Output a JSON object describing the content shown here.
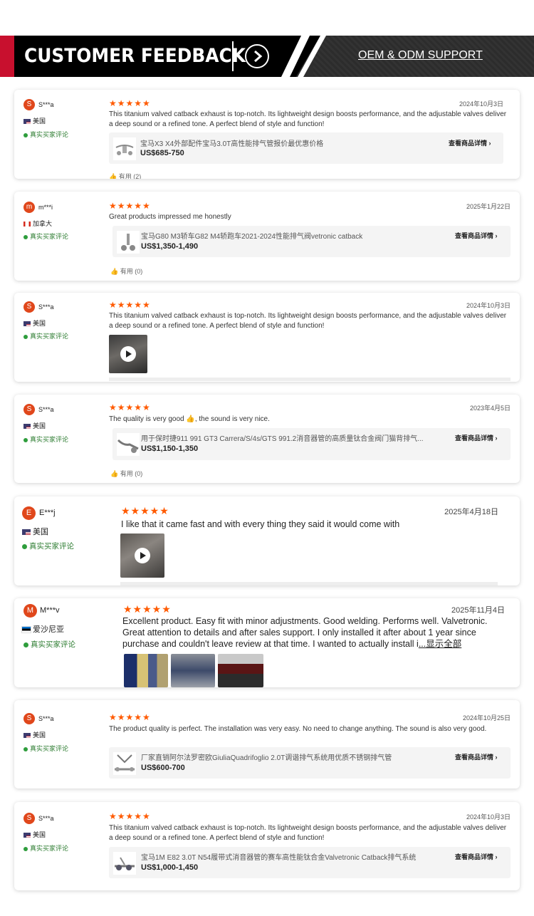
{
  "banner": {
    "title": "CUSTOMER FEEDBACK",
    "support": "OEM & ODM SUPPORT",
    "accent_red": "#c8102e"
  },
  "icons": {
    "arrow": "chevron-right-icon",
    "thumb": "thumbs-up-icon",
    "play": "play-icon",
    "verified": "check-dot-icon"
  },
  "reviews": [
    {
      "initial": "S",
      "user": "S***a",
      "country": "美国",
      "verified": "真实买家评论",
      "stars": "★★★★★",
      "date": "2024年10月3日",
      "text": "This titanium valved catback exhaust is top-notch. Its lightweight design boosts performance, and the adjustable valves deliver a deep sound or a refined tone. A perfect blend of style and function!",
      "product": "宝马X3 X4外部配件宝马3.0T高性能排气管报价最优惠价格",
      "price": "US$685-750",
      "link": "查看商品详情 ›",
      "helpful": "有用 (2)"
    },
    {
      "initial": "m",
      "user": "m***i",
      "country": "加拿大",
      "verified": "真实买家评论",
      "stars": "★★★★★",
      "date": "2025年1月22日",
      "text": "Great products impressed me honestly",
      "product": "宝马G80 M3轿车G82 M4轿跑车2021-2024性能排气阀vetronic catback",
      "price": "US$1,350-1,490",
      "link": "查看商品详情 ›",
      "helpful": "有用 (0)"
    },
    {
      "initial": "S",
      "user": "S***a",
      "country": "美国",
      "verified": "真实买家评论",
      "stars": "★★★★★",
      "date": "2024年10月3日",
      "text": "This titanium valved catback exhaust is top-notch. Its lightweight design boosts performance, and the adjustable valves deliver a deep sound or a refined tone. A perfect blend of style and function!"
    },
    {
      "initial": "S",
      "user": "S***a",
      "country": "美国",
      "verified": "真实买家评论",
      "stars": "★★★★★",
      "date": "2023年4月5日",
      "text": "The quality is very good 👍, the sound is very nice.",
      "product": "用于保时捷911 991 GT3 Carrera/S/4s/GTS 991.2消音器管的高质量钛合金阀门猫背排气...",
      "price": "US$1,150-1,350",
      "link": "查看商品详情 ›",
      "helpful": "有用 (0)"
    },
    {
      "initial": "E",
      "user": "E***j",
      "country": "美国",
      "verified": "真实买家评论",
      "stars": "★★★★★",
      "date": "2025年4月18日",
      "text": "I like that it came fast and with every thing they said it would come with"
    },
    {
      "initial": "M",
      "user": "M***v",
      "country": "爱沙尼亚",
      "verified": "真实买家评论",
      "stars": "★★★★★",
      "date": "2025年11月4日",
      "text": "Excellent product. Easy fit with minor adjustments. Good welding. Performs well. Valvetronic. Great attention to details and after sales support. I only installed it after about 1 year since purchase and couldn't leave review at that time. I wanted to actually install i",
      "more": "...显示全部"
    },
    {
      "initial": "S",
      "user": "S***a",
      "country": "美国",
      "verified": "真实买家评论",
      "stars": "★★★★★",
      "date": "2024年10月25日",
      "text": "The product quality is perfect. The installation was very easy. No need to change anything. The sound is also very good.",
      "product": "厂家直销阿尔法罗密欧GiuliaQuadrifoglio 2.0T调谐排气系统用优质不锈钢排气管",
      "price": "US$600-700",
      "link": "查看商品详情 ›"
    },
    {
      "initial": "S",
      "user": "S***a",
      "country": "美国",
      "verified": "真实买家评论",
      "stars": "★★★★★",
      "date": "2024年10月3日",
      "text": "This titanium valved catback exhaust is top-notch. Its lightweight design boosts performance, and the adjustable valves deliver a deep sound or a refined tone. A perfect blend of style and function!",
      "product": "宝马1M E82 3.0T N54履带式消音器管的赛车高性能钛合金Valvetronic Catback排气系统",
      "price": "US$1,000-1,450",
      "link": "查看商品详情 ›"
    }
  ]
}
